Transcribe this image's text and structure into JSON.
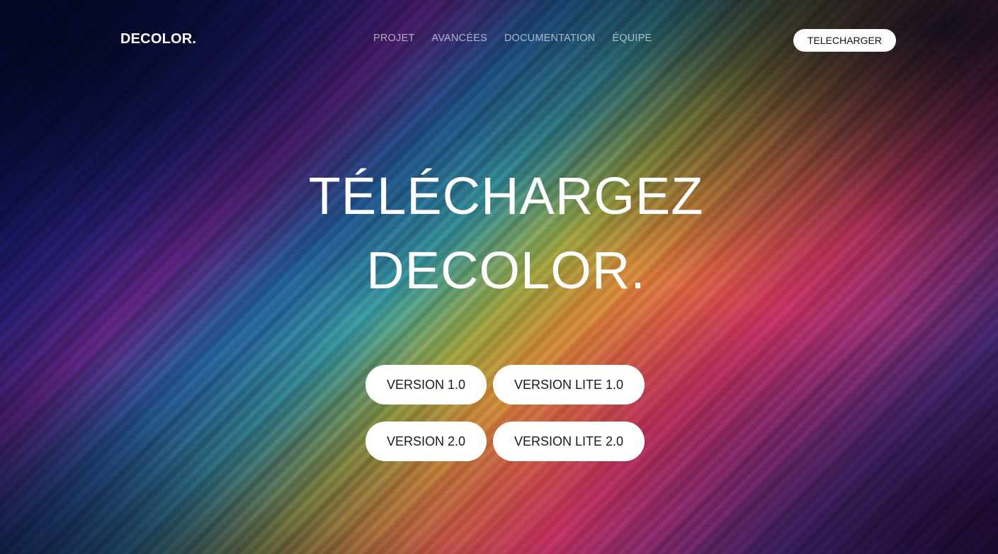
{
  "navbar": {
    "logo": "DECOLOR.",
    "links": [
      {
        "label": "PROJET"
      },
      {
        "label": "AVANCÉES"
      },
      {
        "label": "DOCUMENTATION"
      },
      {
        "label": "ÉQUIPE"
      }
    ],
    "cta_label": "TELECHARGER"
  },
  "hero": {
    "line1": "TÉLÉCHARGEZ",
    "line2": "DECOLOR."
  },
  "versions": [
    {
      "label": "VERSION 1.0"
    },
    {
      "label": "VERSION LITE 1.0"
    },
    {
      "label": "VERSION 2.0"
    },
    {
      "label": "VERSION LITE 2.0"
    }
  ],
  "colors": {
    "button_background": "#ffffff",
    "button_text": "#1a1a1a",
    "nav_link_text": "rgba(255,255,255,0.62)",
    "hero_text": "#ffffff"
  }
}
